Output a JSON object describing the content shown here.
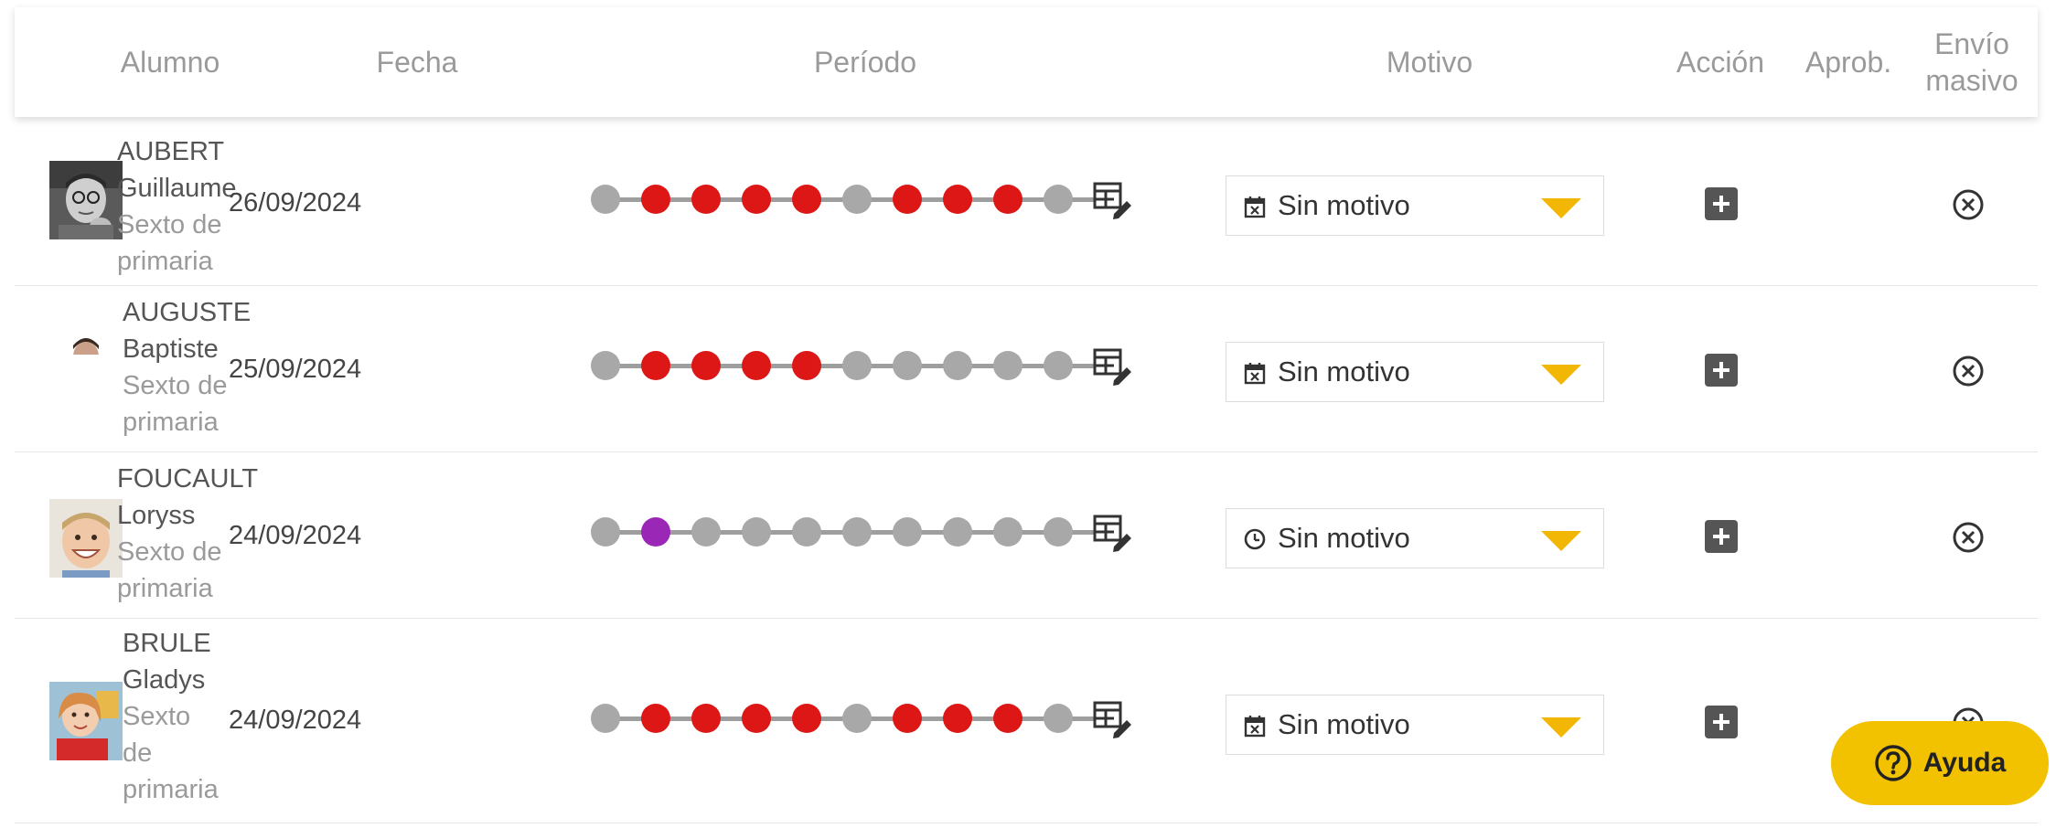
{
  "header": {
    "col_student": "Alumno",
    "col_date": "Fecha",
    "col_period": "Período",
    "col_reason": "Motivo",
    "col_action": "Acción",
    "col_approval": "Aprob.",
    "col_bulk_line1": "Envío",
    "col_bulk_line2": "masivo"
  },
  "colors": {
    "absent": "#dd1616",
    "late": "#9b27b6",
    "neutral": "#a8a8a8",
    "caret": "#f2b705",
    "help_button": "#f2c200"
  },
  "rows": [
    {
      "last_name": "AUBERT",
      "first_name": "Guillaume",
      "grade_l1": "Sexto de",
      "grade_l2": "primaria",
      "grade_l3": "",
      "date": "26/09/2024",
      "period": [
        "neutral",
        "absent",
        "absent",
        "absent",
        "absent",
        "neutral",
        "absent",
        "absent",
        "absent",
        "neutral"
      ],
      "reason": "Sin motivo",
      "reason_icon": "calendar-x-icon"
    },
    {
      "last_name": "AUGUSTE",
      "first_name": "Baptiste",
      "grade_l1": "Sexto de",
      "grade_l2": "primaria",
      "grade_l3": "",
      "date": "25/09/2024",
      "period": [
        "neutral",
        "absent",
        "absent",
        "absent",
        "absent",
        "neutral",
        "neutral",
        "neutral",
        "neutral",
        "neutral"
      ],
      "reason": "Sin motivo",
      "reason_icon": "calendar-x-icon"
    },
    {
      "last_name": "FOUCAULT",
      "first_name": "Loryss",
      "grade_l1": "Sexto de",
      "grade_l2": "primaria",
      "grade_l3": "",
      "date": "24/09/2024",
      "period": [
        "neutral",
        "late",
        "neutral",
        "neutral",
        "neutral",
        "neutral",
        "neutral",
        "neutral",
        "neutral",
        "neutral"
      ],
      "reason": "Sin motivo",
      "reason_icon": "clock-icon"
    },
    {
      "last_name": "BRULE",
      "first_name": "Gladys",
      "grade_l1": "Sexto",
      "grade_l2": "de",
      "grade_l3": "primaria",
      "date": "24/09/2024",
      "period": [
        "neutral",
        "absent",
        "absent",
        "absent",
        "absent",
        "neutral",
        "absent",
        "absent",
        "absent",
        "neutral"
      ],
      "reason": "Sin motivo",
      "reason_icon": "calendar-x-icon"
    }
  ],
  "help": {
    "label": "Ayuda",
    "icon": "question-circle-icon"
  }
}
